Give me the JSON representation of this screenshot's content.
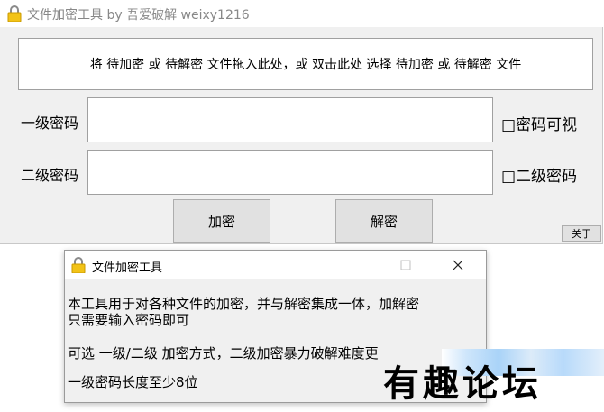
{
  "main": {
    "title": "文件加密工具 by 吾爱破解 weixy1216",
    "drop_hint": "将 待加密 或 待解密 文件拖入此处，或 双击此处 选择 待加密 或 待解密 文件",
    "level1_label": "一级密码",
    "level1_value": "",
    "level2_label": "二级密码",
    "level2_value": "",
    "show_password_label": "□密码可视",
    "level2_check_label": "□二级密码",
    "encrypt_label": "加密",
    "decrypt_label": "解密",
    "about_label": "关于"
  },
  "dialog": {
    "title": "文件加密工具",
    "line1": "本工具用于对各种文件的加密，并与解密集成一体，加解密",
    "line2": "只需要输入密码即可",
    "line3": "可选 一级/二级 加密方式，二级加密暴力破解难度更",
    "line4": "一级密码长度至少8位"
  },
  "watermark": "有趣论坛",
  "colors": {
    "window_bg": "#f0f0f0",
    "titlebar_bg": "#ffffff",
    "button_bg": "#e1e1e1",
    "lock": "#f2c318"
  }
}
